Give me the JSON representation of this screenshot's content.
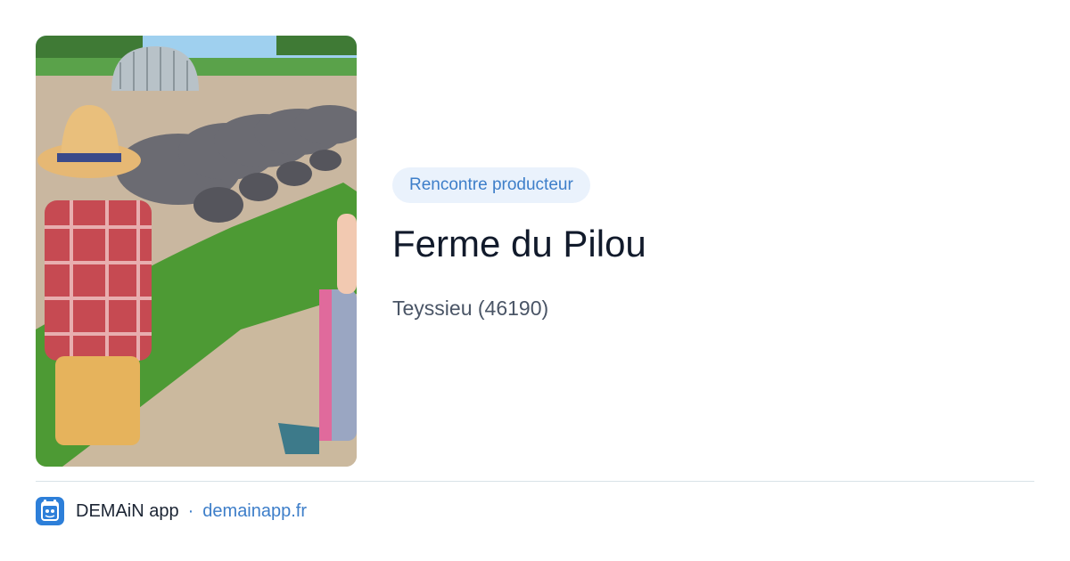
{
  "card": {
    "tag": "Rencontre producteur",
    "title": "Ferme du Pilou",
    "location": "Teyssieu (46190)"
  },
  "footer": {
    "app_name": "DEMAiN app",
    "separator": "·",
    "site": "demainapp.fr"
  },
  "colors": {
    "accent": "#3d7ec9",
    "tag_bg": "#eaf2fc",
    "title": "#111a2b",
    "divider": "#d9e3e8"
  },
  "icons": {
    "app": "demain-app-icon"
  }
}
